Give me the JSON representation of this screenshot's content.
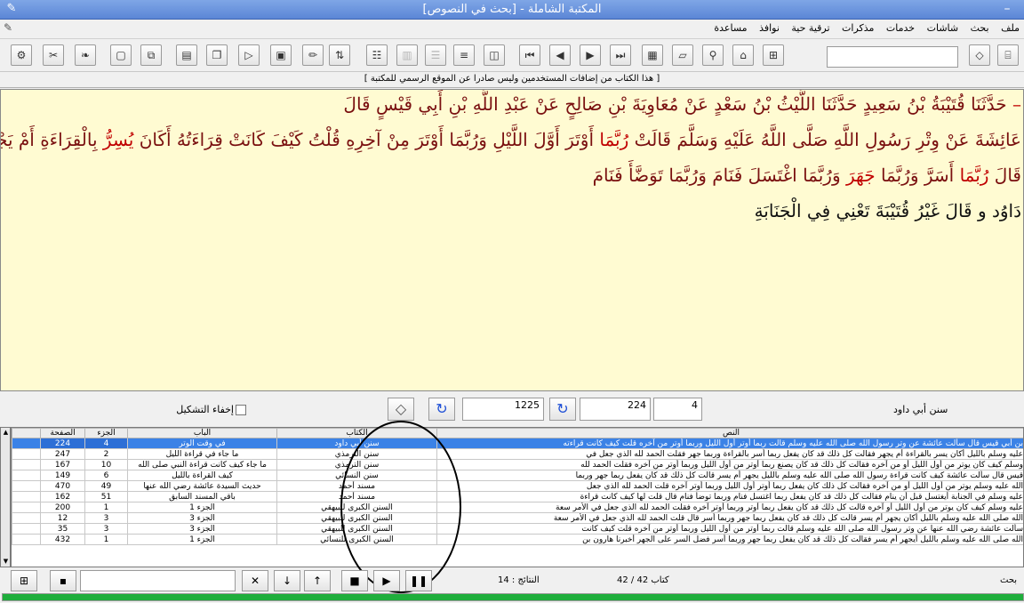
{
  "window": {
    "title": "المكتبة الشاملة - [بحث في النصوص]"
  },
  "menu": [
    "ملف",
    "بحث",
    "شاشات",
    "خدمات",
    "مذكرات",
    "ترقية حية",
    "نوافذ",
    "مساعدة"
  ],
  "notice": "[ هذا الكتاب من إضافات المستخدمين وليس صادرا عن الموقع الرسمي للمكتبة ]",
  "text": {
    "line1": {
      "a": "– ",
      "b": "حَدَّثَنَا قُتَيْبَةُ بْنُ سَعِيدٍ حَدَّثَنَا اللَّيْثُ بْنُ سَعْدٍ عَنْ مُعَاوِيَةَ بْنِ صَالِحٍ عَنْ عَبْدِ اللَّهِ بْنِ أَبِي قَيْسٍ قَالَ"
    },
    "line2": {
      "a": "عَائِشَةَ عَنْ وِتْرِ رَسُولِ اللَّهِ صَلَّى اللَّهُ عَلَيْهِ وَسَلَّمَ قَالَتْ ",
      "b": "رُبَّمَا",
      "c": " أَوْتَرَ أَوَّلَ اللَّيْلِ وَرُبَّمَا أَوْتَرَ مِنْ آخِرِهِ قُلْتُ كَيْفَ كَانَتْ قِرَاءَتُهُ أَكَانَ ",
      "d": "يُسِرُّ",
      "e": " بِالْقِرَاءَةِ أَمْ يَجْهَرُ قَالَتْ كُلَّ ذَلِكَ"
    },
    "line3": {
      "a": "قَالَ ",
      "b": "رُبَّمَا",
      "c": " أَسَرَّ وَرُبَّمَا ",
      "d": "جَهَرَ",
      "e": " وَرُبَّمَا اغْتَسَلَ فَنَامَ وَرُبَّمَا تَوَضَّأَ فَنَامَ"
    },
    "line4": "دَاوُد و قَالَ غَيْرُ قُتَيْبَةَ تَعْنِي فِي الْجَنَابَةِ"
  },
  "controls": {
    "hide_diacritics": "إخفاء التشكيل",
    "field_1225": "1225",
    "field_224": "224",
    "field_4": "4",
    "book_name": "سنن أبي داود"
  },
  "table": {
    "headers": {
      "text": "النص",
      "book": "الكتاب",
      "chapter": "الباب",
      "part": "الجزء",
      "page": "الصفحة"
    },
    "rows": [
      {
        "page": "224",
        "part": "4",
        "chapter": "في وقت الوتر",
        "book": "سنن أبي داود",
        "text": "بن أبي قيس قال سألت عائشة عن وتر رسول الله صلى الله عليه وسلم قالت ربما أوتر أول الليل وربما أوتر من آخره قلت كيف كانت قراءته"
      },
      {
        "page": "247",
        "part": "2",
        "chapter": "ما جاء في قراءة الليل",
        "book": "سنن الترمذي",
        "text": "عليه وسلم بالليل أكان يسر بالقراءة أم يجهر فقالت كل ذلك قد كان يفعل ربما أسر بالقراءة وربما جهر فقلت الحمد لله الذي جعل في"
      },
      {
        "page": "167",
        "part": "10",
        "chapter": "ما جاء كيف كانت قراءة النبي صلى الله",
        "book": "سنن الترمذي",
        "text": "وسلم كيف كان يوتر من أول الليل أو من آخره فقالت كل ذلك قد كان يصنع ربما أوتر من أول الليل وربما أوتر من آخره فقلت الحمد لله"
      },
      {
        "page": "149",
        "part": "6",
        "chapter": "كيف القراءة بالليل",
        "book": "سنن النسائي",
        "text": "قيس قال سألت عائشة كيف كانت قراءة رسول الله صلى الله عليه وسلم بالليل يجهر أم يسر قالت كل ذلك قد كان يفعل ربما جهر وربما"
      },
      {
        "page": "470",
        "part": "49",
        "chapter": "حديث السيدة عائشة رضي الله عنها",
        "book": "مسند أحمد",
        "text": "الله عليه وسلم يوتر من أول الليل أو من آخره فقالت كل ذلك كان يفعل ربما أوتر أول الليل وربما أوتر آخره قلت الحمد لله الذي جعل"
      },
      {
        "page": "162",
        "part": "51",
        "chapter": "باقي المسند السابق",
        "book": "مسند أحمد",
        "text": "عليه وسلم في الجنابة أيغتسل قبل أن ينام فقالت كل ذلك قد كان يفعل ربما اغتسل فنام وربما توضأ فنام قال قلت لها كيف كانت قراءة"
      },
      {
        "page": "200",
        "part": "1",
        "chapter": "الجزء 1",
        "book": "السنن الكبرى للبيهقي",
        "text": "عليه وسلم كيف كان يوتر من أول الليل أو آخره قالت كل ذلك قد كان يفعل ربما أوتر وربما أوتر آخره فقلت الحمد لله الذي جعل في الأمر سعة"
      },
      {
        "page": "12",
        "part": "3",
        "chapter": "الجزء 3",
        "book": "السنن الكبرى للبيهقي",
        "text": "الله صلى الله عليه وسلم بالليل أكان يجهر أم يسر قالت كل ذلك قد كان يفعل ربما جهر وربما أسر قال قلت الحمد لله الذي جعل في الأمر سعة"
      },
      {
        "page": "35",
        "part": "3",
        "chapter": "الجزء 3",
        "book": "السنن الكبرى للبيهقي",
        "text": "سألت عائشة رضي الله عنها عن وتر رسول الله صلى الله عليه وسلم قالت ربما أوتر من أول الليل وربما أوتر من آخره قلت كيف كانت"
      },
      {
        "page": "432",
        "part": "1",
        "chapter": "الجزء 1",
        "book": "السنن الكبرى للنسائي",
        "text": "الله صلى الله عليه وسلم بالليل أيجهر أم يسر فقالت كل ذلك قد كان يفعل ربما جهر وربما أسر فضل السر على الجهر أخبرنا هارون بن"
      }
    ]
  },
  "status": {
    "results": "النتائج : 14",
    "book_progress": "كتاب 42 / 42",
    "progress_fraction": 1.0,
    "search_label": "بحث"
  }
}
